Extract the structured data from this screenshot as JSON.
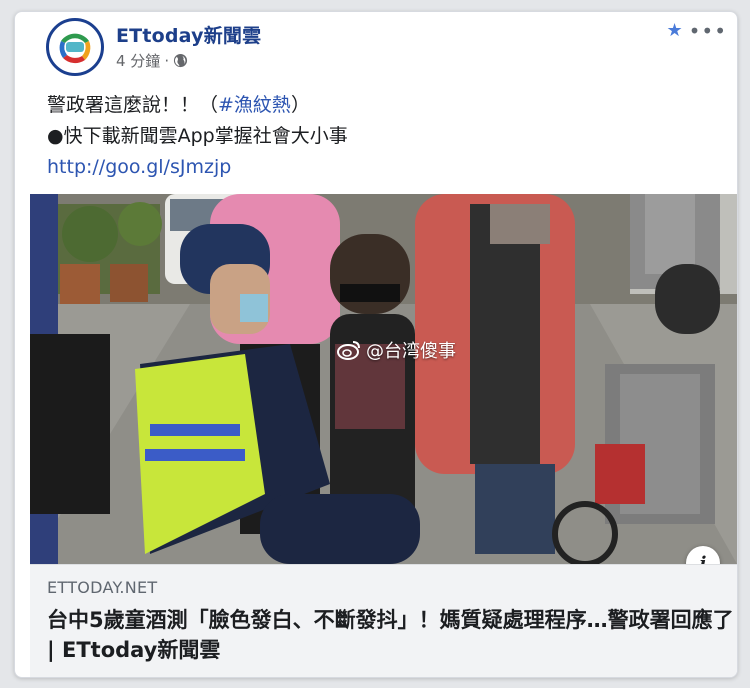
{
  "header": {
    "page_name": "ETtoday新聞雲",
    "time_ago": "4 分鐘",
    "separator": "·"
  },
  "icons": {
    "avatar": "ettoday-logo-icon",
    "privacy": "globe-icon",
    "favorite": "star-icon",
    "menu": "more-options-icon",
    "info": "info-icon",
    "watermark": "weibo-icon"
  },
  "post": {
    "line1_prefix": "警政署這麼說！！（",
    "line1_hashtag": "#漁紋熱",
    "line1_suffix": "）",
    "line2": "●快下載新聞雲App掌握社會大小事",
    "line3_link": "http://goo.gl/sJmzjp"
  },
  "photo": {
    "watermark_text": "@台湾傻事"
  },
  "link_preview": {
    "domain": "ETTODAY.NET",
    "headline": "台中5歲童酒測「臉色發白、不斷發抖」！媽質疑處理程序…警政署回應了 | ETtoday新聞雲",
    "info_label": "i"
  },
  "colors": {
    "brand_blue": "#1d3f8a",
    "link_blue": "#2d55b1",
    "meta_gray": "#65676b",
    "footer_bg": "#f2f3f5"
  }
}
